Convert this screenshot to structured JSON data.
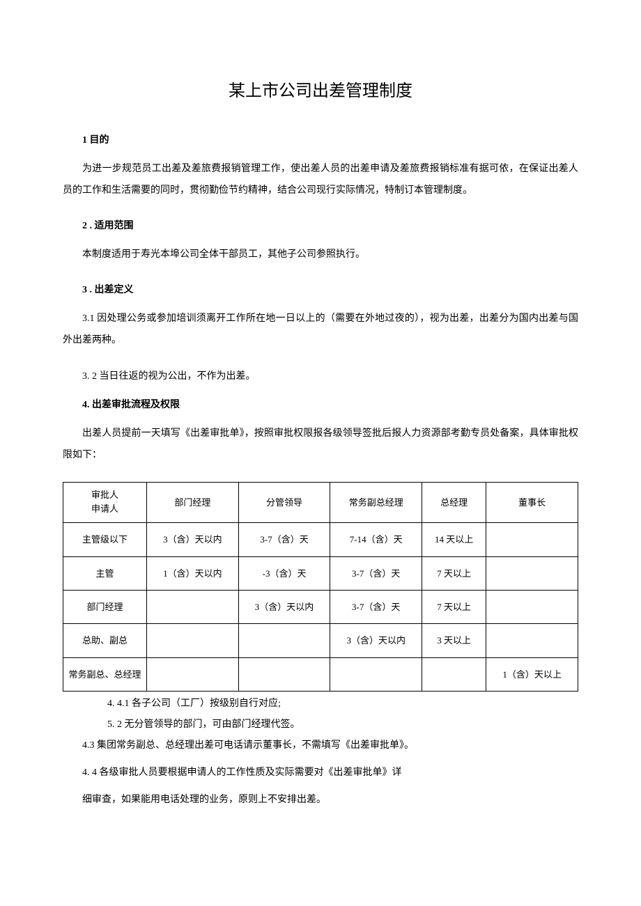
{
  "title": "某上市公司出差管理制度",
  "s1": {
    "heading": "1 目的",
    "p1": "为进一步规范员工出差及差旅费报销管理工作，使出差人员的出差申请及差旅费报销标准有据可依，在保证出差人员的工作和生活需要的同时，贯彻勤俭节约精神，结合公司现行实际情况，特制订本管理制度。"
  },
  "s2": {
    "heading": "2 . 适用范围",
    "p1": "本制度适用于寿光本埠公司全体干部员工，其他子公司参照执行。"
  },
  "s3": {
    "heading": "3 . 出差定义",
    "p1": "3.1 因处理公务或参加培训须离开工作所在地一日以上的（需要在外地过夜的），视为出差，出差分为国内出差与国外出差两种。",
    "p2": "3. 2 当日往返的视为公出，不作为出差。"
  },
  "s4": {
    "heading": "4. 出差审批流程及权限",
    "p1": "出差人员提前一天填写《出差审批单》，按照审批权限报各级领导签批后报人力资源部考勤专员处备案，具体审批权限如下：",
    "n1": "4. 4.1 各子公司（工厂）按级别自行对应;",
    "n2": "5. 2 无分管领导的部门，可由部门经理代签。",
    "n3": "4.3 集团常务副总、总经理出差可电话请示董事长，不需填写《出差审批单》。",
    "n4a": "4. 4 各级审批人员要根据申请人的工作性质及实际需要对《出差审批单》详",
    "n4b": "细审查，如果能用电话处理的业务，原则上不安排出差。"
  },
  "table": {
    "header": {
      "split_top": "审批人",
      "split_bottom": "申请人",
      "c2": "部门经理",
      "c3": "分管领导",
      "c4": "常务副总经理",
      "c5": "总经理",
      "c6": "董事长"
    },
    "rows": [
      {
        "c1": "主管级以下",
        "c2": "3（含）天以内",
        "c3": "3-7（含）天",
        "c4": "7-14（含）天",
        "c5": "14 天以上",
        "c6": ""
      },
      {
        "c1": "主管",
        "c2": "1（含）天以内",
        "c3": "-3（含）天",
        "c4": "3-7（含）天",
        "c5": "7 天以上",
        "c6": ""
      },
      {
        "c1": "部门经理",
        "c2": "",
        "c3": "3（含）天以内",
        "c4": "3-7（含）天",
        "c5": "7 天以上",
        "c6": ""
      },
      {
        "c1": "总助、副总",
        "c2": "",
        "c3": "",
        "c4": "3（含）天以内",
        "c5": "3 天以上",
        "c6": ""
      },
      {
        "c1": "常务副总、总经理",
        "c2": "",
        "c3": "",
        "c4": "",
        "c5": "",
        "c6": "1（含）天以上"
      }
    ]
  }
}
